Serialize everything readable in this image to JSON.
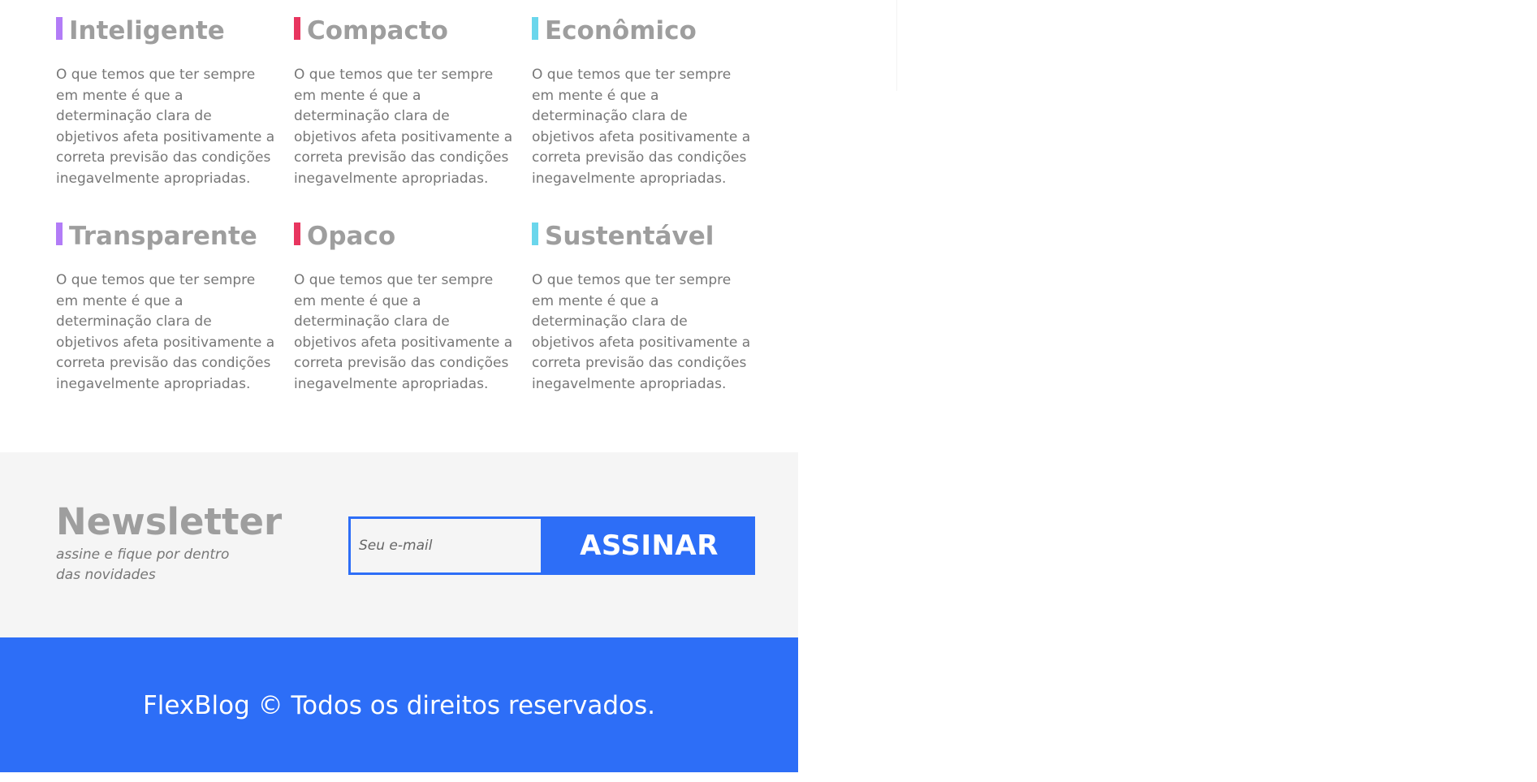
{
  "features": [
    {
      "title": "Inteligente",
      "accent": "#b27cf7",
      "text": "O que temos que ter sempre em mente é que a determinação clara de objetivos afeta positivamente a correta previsão das condições inegavelmente apropriadas."
    },
    {
      "title": "Compacto",
      "accent": "#e8355f",
      "text": "O que temos que ter sempre em mente é que a determinação clara de objetivos afeta positivamente a correta previsão das condições inegavelmente apropriadas."
    },
    {
      "title": "Econômico",
      "accent": "#6ad6ec",
      "text": "O que temos que ter sempre em mente é que a determinação clara de objetivos afeta positivamente a correta previsão das condições inegavelmente apropriadas."
    },
    {
      "title": "Transparente",
      "accent": "#b27cf7",
      "text": "O que temos que ter sempre em mente é que a determinação clara de objetivos afeta positivamente a correta previsão das condições inegavelmente apropriadas."
    },
    {
      "title": "Opaco",
      "accent": "#e8355f",
      "text": "O que temos que ter sempre em mente é que a determinação clara de objetivos afeta positivamente a correta previsão das condições inegavelmente apropriadas."
    },
    {
      "title": "Sustentável",
      "accent": "#6ad6ec",
      "text": "O que temos que ter sempre em mente é que a determinação clara de objetivos afeta positivamente a correta previsão das condições inegavelmente apropriadas."
    }
  ],
  "newsletter": {
    "title": "Newsletter",
    "subtitle": "assine e fique por dentro das novidades",
    "email_placeholder": "Seu e-mail",
    "email_value": "",
    "submit_label": "ASSINAR"
  },
  "footer": {
    "text": "FlexBlog © Todos os direitos reservados."
  },
  "colors": {
    "primary": "#2d6ef7",
    "heading": "#9e9e9e",
    "body_text": "#777777",
    "newsletter_bg": "#f5f5f5"
  }
}
